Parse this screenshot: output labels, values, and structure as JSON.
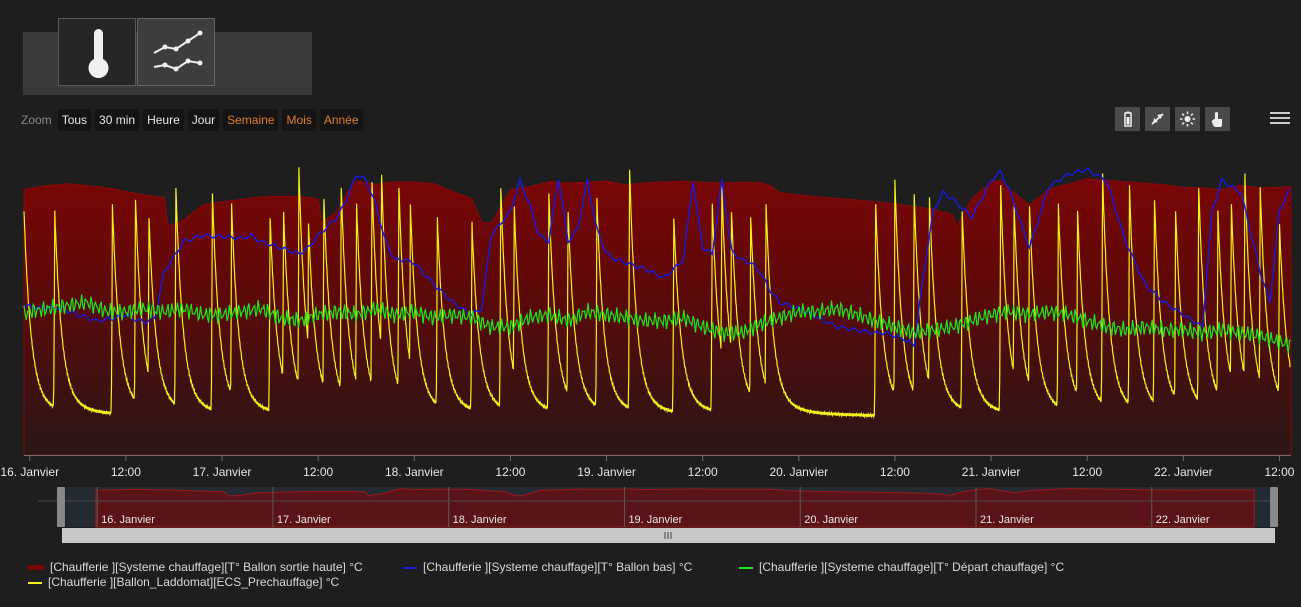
{
  "view_toggle": {
    "items": [
      "thermometer-view",
      "chart-view"
    ],
    "active": "chart-view"
  },
  "zoom": {
    "label": "Zoom",
    "buttons": [
      "Tous",
      "30 min",
      "Heure",
      "Jour",
      "Semaine",
      "Mois",
      "Année"
    ],
    "orange_buttons": [
      "Semaine",
      "Mois",
      "Année"
    ]
  },
  "toolbar": {
    "icons": [
      "battery-icon",
      "collapse-arrows-icon",
      "sun-icon",
      "hand-pointer-icon"
    ],
    "menu": "hamburger-menu-icon"
  },
  "colors": {
    "background": "#1e1e1e",
    "area_top": "#7a0606",
    "area_bottom": "#2a1616",
    "blue": "#1a1ad8",
    "green": "#22e41c",
    "yellow": "#f2f21c",
    "orange_text": "#e07d2a"
  },
  "chart_data": {
    "type": "line",
    "x_ticks": [
      "16. Janvier",
      "12:00",
      "17. Janvier",
      "12:00",
      "18. Janvier",
      "12:00",
      "19. Janvier",
      "12:00",
      "20. Janvier",
      "12:00",
      "21. Janvier",
      "12:00",
      "22. Janvier",
      "12:00"
    ],
    "x_range_days": [
      15.97,
      22.56
    ],
    "navigator_ticks": [
      "16. Janvier",
      "17. Janvier",
      "18. Janvier",
      "19. Janvier",
      "20. Janvier",
      "21. Janvier",
      "22. Janvier"
    ],
    "navigator_range_days": [
      15.8,
      22.65
    ],
    "y_range": [
      15,
      65
    ],
    "grid": false,
    "legend_position": "bottom",
    "series": [
      {
        "name": "[Chaufferie ][Systeme chauffage][T° Ballon sortie haute] °C",
        "type": "area",
        "color": "#7a0606",
        "x": [
          15.97,
          16.05,
          16.2,
          16.4,
          16.5,
          16.6,
          16.7,
          16.72,
          16.8,
          16.9,
          17.0,
          17.1,
          17.2,
          17.3,
          17.4,
          17.5,
          17.52,
          17.6,
          17.65,
          17.7,
          17.75,
          17.8,
          17.85,
          17.9,
          18.0,
          18.1,
          18.2,
          18.3,
          18.35,
          18.4,
          18.5,
          18.6,
          18.7,
          18.72,
          18.75,
          18.8,
          18.9,
          19.0,
          19.1,
          19.2,
          19.4,
          19.5,
          19.6,
          19.75,
          19.8,
          19.85,
          19.9,
          20.1,
          20.3,
          20.5,
          20.7,
          20.8,
          20.82,
          20.9,
          21.0,
          21.05,
          21.1,
          21.2,
          21.3,
          21.5,
          21.7,
          21.9,
          22.0,
          22.1,
          22.2,
          22.3,
          22.4,
          22.5,
          22.56
        ],
        "y": [
          58.5,
          59.0,
          59.5,
          58.8,
          58.2,
          57.6,
          57.2,
          52.5,
          53.5,
          56.0,
          56.5,
          56.9,
          57.3,
          57.4,
          57.4,
          57.0,
          53.0,
          55.0,
          58.0,
          60.0,
          59.6,
          59.4,
          59.6,
          59.8,
          59.7,
          59.5,
          58.2,
          57.0,
          53.2,
          53.0,
          58.5,
          59.0,
          59.8,
          59.9,
          59.6,
          59.6,
          59.7,
          59.9,
          59.3,
          59.6,
          59.9,
          59.7,
          59.6,
          59.7,
          59.6,
          59.2,
          58.0,
          57.3,
          56.8,
          56.2,
          55.3,
          54.4,
          52.5,
          57.0,
          59.8,
          60.0,
          58.5,
          56.0,
          58.5,
          60.3,
          59.8,
          59.3,
          58.9,
          58.8,
          58.5,
          59.2,
          58.8,
          58.9,
          59.0
        ]
      },
      {
        "name": "[Chaufferie ][Systeme chauffage][T° Ballon bas] °C",
        "type": "line",
        "color": "#1a1ad8",
        "x": [
          15.97,
          16.05,
          16.15,
          16.25,
          16.35,
          16.45,
          16.5,
          16.55,
          16.6,
          16.65,
          16.7,
          16.8,
          16.9,
          17.0,
          17.1,
          17.15,
          17.2,
          17.3,
          17.4,
          17.45,
          17.5,
          17.6,
          17.65,
          17.7,
          17.75,
          17.8,
          17.85,
          17.9,
          17.95,
          18.0,
          18.1,
          18.2,
          18.3,
          18.35,
          18.4,
          18.5,
          18.55,
          18.6,
          18.65,
          18.7,
          18.75,
          18.8,
          18.85,
          18.9,
          18.95,
          19.0,
          19.05,
          19.1,
          19.2,
          19.3,
          19.4,
          19.45,
          19.5,
          19.55,
          19.6,
          19.65,
          19.7,
          19.75,
          19.8,
          19.85,
          19.9,
          20.0,
          20.1,
          20.2,
          20.3,
          20.4,
          20.45,
          20.5,
          20.55,
          20.6,
          20.65,
          20.7,
          20.75,
          20.8,
          20.9,
          21.0,
          21.05,
          21.1,
          21.2,
          21.3,
          21.4,
          21.5,
          21.6,
          21.7,
          21.8,
          21.9,
          22.0,
          22.1,
          22.15,
          22.2,
          22.3,
          22.4,
          22.45,
          22.5,
          22.56
        ],
        "y": [
          39.5,
          39.0,
          39.2,
          38.0,
          37.0,
          37.5,
          38.0,
          37.2,
          36.8,
          37.5,
          45.0,
          50.0,
          51.0,
          50.8,
          50.5,
          51.0,
          50.0,
          49.0,
          48.0,
          49.0,
          51.0,
          54.0,
          57.0,
          61.0,
          60.0,
          56.0,
          50.0,
          47.0,
          47.0,
          46.5,
          43.0,
          40.0,
          38.0,
          39.0,
          51.0,
          55.0,
          60.0,
          56.0,
          51.0,
          50.0,
          60.5,
          50.0,
          52.0,
          60.0,
          52.0,
          48.0,
          47.0,
          46.5,
          45.5,
          44.0,
          47.0,
          60.0,
          49.0,
          48.0,
          60.0,
          48.5,
          47.0,
          46.5,
          45.0,
          42.0,
          40.0,
          39.0,
          37.5,
          36.0,
          35.5,
          35.0,
          35.0,
          34.5,
          34.0,
          33.0,
          45.0,
          55.0,
          58.0,
          57.0,
          54.0,
          60.0,
          61.5,
          58.0,
          49.0,
          59.0,
          61.0,
          61.8,
          60.0,
          50.0,
          43.0,
          40.0,
          38.0,
          36.0,
          55.0,
          60.0,
          58.0,
          45.0,
          40.0,
          55.0,
          59.0
        ]
      },
      {
        "name": "[Chaufferie ][Systeme chauffage][T° Départ chauffage] °C",
        "type": "line",
        "color": "#22e41c",
        "x": [
          15.97,
          16.0,
          16.1,
          16.2,
          16.3,
          16.4,
          16.5,
          16.6,
          16.7,
          16.8,
          16.9,
          17.0,
          17.1,
          17.2,
          17.3,
          17.4,
          17.5,
          17.6,
          17.7,
          17.8,
          17.9,
          18.0,
          18.1,
          18.2,
          18.3,
          18.4,
          18.5,
          18.6,
          18.7,
          18.8,
          18.9,
          19.0,
          19.1,
          19.2,
          19.3,
          19.4,
          19.5,
          19.6,
          19.7,
          19.8,
          19.9,
          20.0,
          20.1,
          20.2,
          20.3,
          20.4,
          20.5,
          20.6,
          20.7,
          20.8,
          20.9,
          21.0,
          21.1,
          21.2,
          21.3,
          21.4,
          21.5,
          21.6,
          21.7,
          21.8,
          21.9,
          22.0,
          22.1,
          22.2,
          22.3,
          22.4,
          22.5,
          22.56
        ],
        "y": [
          38.0,
          38.5,
          39.0,
          39.5,
          40.0,
          38.5,
          38.5,
          39.0,
          38.5,
          39.0,
          38.0,
          38.0,
          38.5,
          39.0,
          37.5,
          37.0,
          38.0,
          38.5,
          38.0,
          39.0,
          38.0,
          38.5,
          37.5,
          38.0,
          37.5,
          36.0,
          36.0,
          37.5,
          38.0,
          37.0,
          38.5,
          38.0,
          37.5,
          37.0,
          37.0,
          37.5,
          36.0,
          35.0,
          35.0,
          36.5,
          37.5,
          38.5,
          38.5,
          39.0,
          38.0,
          37.0,
          36.0,
          35.0,
          35.5,
          36.0,
          37.0,
          38.0,
          38.5,
          38.0,
          38.5,
          38.0,
          37.0,
          36.0,
          35.5,
          36.0,
          35.5,
          35.5,
          35.0,
          35.5,
          35.0,
          34.5,
          33.5,
          33.0
        ]
      },
      {
        "name": "[Chaufferie ][Ballon_Laddomat][ECS_Prechauffage] °C",
        "type": "line",
        "color": "#f2f21c",
        "baseline_low": 21.5,
        "spike_days": [
          15.97,
          16.13,
          16.43,
          16.55,
          16.62,
          16.76,
          16.95,
          17.05,
          17.25,
          17.32,
          17.4,
          17.45,
          17.53,
          17.62,
          17.7,
          17.78,
          17.83,
          17.92,
          17.98,
          18.12,
          18.3,
          18.45,
          18.52,
          18.7,
          18.8,
          18.95,
          19.12,
          19.35,
          19.55,
          19.6,
          19.65,
          19.75,
          19.83,
          20.4,
          20.5,
          20.6,
          20.68,
          20.85,
          21.05,
          21.12,
          21.2,
          21.35,
          21.45,
          21.58,
          21.72,
          21.85,
          21.96,
          22.08,
          22.18,
          22.25,
          22.32,
          22.4,
          22.5
        ],
        "spike_peaks": [
          51,
          51,
          52,
          53,
          50,
          55,
          54,
          52,
          50,
          51,
          58,
          49,
          53,
          55,
          52,
          56,
          57,
          55,
          52,
          50,
          49,
          55,
          52,
          54,
          51,
          53,
          58,
          50,
          52,
          55,
          51,
          50,
          52,
          52,
          56,
          54,
          53,
          51,
          55,
          52,
          52,
          52,
          51,
          57,
          55,
          53,
          51,
          55,
          51,
          52,
          57,
          55,
          49
        ]
      }
    ]
  },
  "navigator": {
    "series": "[Chaufferie ][Systeme chauffage][T° Ballon sortie haute] °C"
  }
}
